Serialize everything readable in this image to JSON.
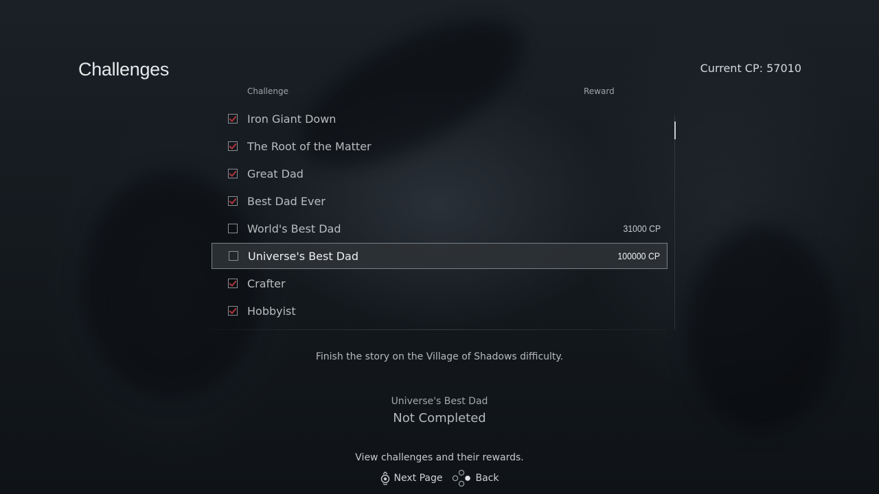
{
  "header": {
    "title": "Challenges",
    "current_cp": "Current CP: 57010"
  },
  "columns": {
    "challenge": "Challenge",
    "reward": "Reward"
  },
  "challenges": [
    {
      "label": "Iron Giant Down",
      "completed": true,
      "reward": ""
    },
    {
      "label": "The Root of the Matter",
      "completed": true,
      "reward": ""
    },
    {
      "label": "Great Dad",
      "completed": true,
      "reward": ""
    },
    {
      "label": "Best Dad Ever",
      "completed": true,
      "reward": ""
    },
    {
      "label": "World's Best Dad",
      "completed": false,
      "reward": "31000 CP"
    },
    {
      "label": "Universe's Best Dad",
      "completed": false,
      "reward": "100000 CP",
      "selected": true
    },
    {
      "label": "Crafter",
      "completed": true,
      "reward": ""
    },
    {
      "label": "Hobbyist",
      "completed": true,
      "reward": ""
    }
  ],
  "details": {
    "description": "Finish the story on the Village of Shadows difficulty.",
    "name": "Universe's Best Dad",
    "status": "Not Completed"
  },
  "footer": {
    "help": "View challenges and their rewards.",
    "next_page": "Next Page",
    "back": "Back"
  },
  "colors": {
    "check_mark": "#b0353f",
    "selected_border": "#7c8185"
  },
  "icons": {
    "next_page": "right-stick-icon",
    "back": "dpad-buttons-icon"
  }
}
